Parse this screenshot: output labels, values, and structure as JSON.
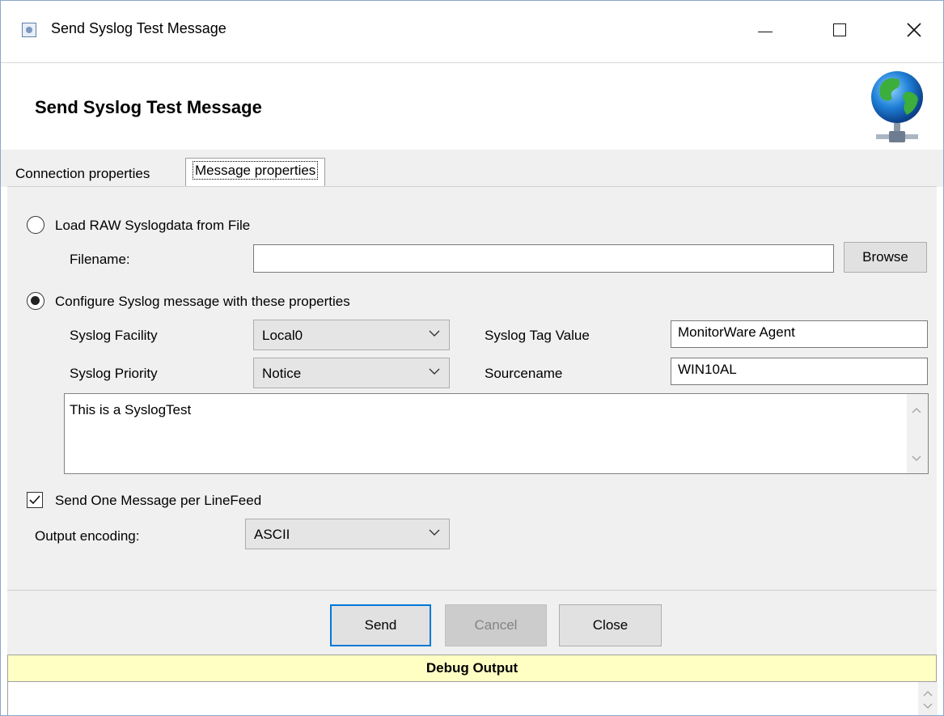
{
  "window": {
    "title": "Send Syslog Test Message",
    "controls": {
      "minimize": "minimize-icon",
      "maximize": "maximize-icon",
      "close": "close-icon"
    }
  },
  "header": {
    "title": "Send Syslog Test Message",
    "icon": "globe-network-icon"
  },
  "tabs": [
    {
      "label": "Connection properties",
      "active": false
    },
    {
      "label": "Message properties",
      "active": true
    }
  ],
  "raw_file": {
    "radio_label": "Load RAW Syslogdata from File",
    "selected": false,
    "filename_label": "Filename:",
    "filename_value": "",
    "browse_label": "Browse"
  },
  "configure": {
    "radio_label": "Configure Syslog message with these properties",
    "selected": true,
    "facility_label": "Syslog Facility",
    "facility_value": "Local0",
    "priority_label": "Syslog Priority",
    "priority_value": "Notice",
    "tag_label": "Syslog Tag Value",
    "tag_value": "MonitorWare Agent",
    "source_label": "Sourcename",
    "source_value": "WIN10AL",
    "message_text": "This is a SyslogTest"
  },
  "options": {
    "linefeed_label": "Send One Message per LineFeed",
    "linefeed_checked": true,
    "encoding_label": "Output encoding:",
    "encoding_value": "ASCII"
  },
  "buttons": {
    "send": "Send",
    "cancel": "Cancel",
    "close": "Close"
  },
  "debug": {
    "title": "Debug Output",
    "content": ""
  },
  "colors": {
    "focus_border": "#0078d7",
    "debug_background": "#ffffc4",
    "panel_background": "#f0f0f0"
  }
}
